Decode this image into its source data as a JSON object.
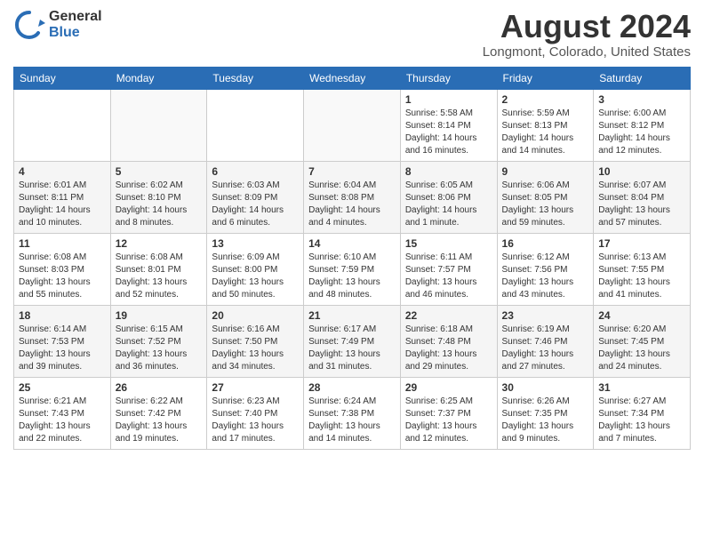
{
  "logo": {
    "general": "General",
    "blue": "Blue"
  },
  "header": {
    "month_year": "August 2024",
    "location": "Longmont, Colorado, United States"
  },
  "weekdays": [
    "Sunday",
    "Monday",
    "Tuesday",
    "Wednesday",
    "Thursday",
    "Friday",
    "Saturday"
  ],
  "weeks": [
    [
      {
        "day": "",
        "info": ""
      },
      {
        "day": "",
        "info": ""
      },
      {
        "day": "",
        "info": ""
      },
      {
        "day": "",
        "info": ""
      },
      {
        "day": "1",
        "info": "Sunrise: 5:58 AM\nSunset: 8:14 PM\nDaylight: 14 hours\nand 16 minutes."
      },
      {
        "day": "2",
        "info": "Sunrise: 5:59 AM\nSunset: 8:13 PM\nDaylight: 14 hours\nand 14 minutes."
      },
      {
        "day": "3",
        "info": "Sunrise: 6:00 AM\nSunset: 8:12 PM\nDaylight: 14 hours\nand 12 minutes."
      }
    ],
    [
      {
        "day": "4",
        "info": "Sunrise: 6:01 AM\nSunset: 8:11 PM\nDaylight: 14 hours\nand 10 minutes."
      },
      {
        "day": "5",
        "info": "Sunrise: 6:02 AM\nSunset: 8:10 PM\nDaylight: 14 hours\nand 8 minutes."
      },
      {
        "day": "6",
        "info": "Sunrise: 6:03 AM\nSunset: 8:09 PM\nDaylight: 14 hours\nand 6 minutes."
      },
      {
        "day": "7",
        "info": "Sunrise: 6:04 AM\nSunset: 8:08 PM\nDaylight: 14 hours\nand 4 minutes."
      },
      {
        "day": "8",
        "info": "Sunrise: 6:05 AM\nSunset: 8:06 PM\nDaylight: 14 hours\nand 1 minute."
      },
      {
        "day": "9",
        "info": "Sunrise: 6:06 AM\nSunset: 8:05 PM\nDaylight: 13 hours\nand 59 minutes."
      },
      {
        "day": "10",
        "info": "Sunrise: 6:07 AM\nSunset: 8:04 PM\nDaylight: 13 hours\nand 57 minutes."
      }
    ],
    [
      {
        "day": "11",
        "info": "Sunrise: 6:08 AM\nSunset: 8:03 PM\nDaylight: 13 hours\nand 55 minutes."
      },
      {
        "day": "12",
        "info": "Sunrise: 6:08 AM\nSunset: 8:01 PM\nDaylight: 13 hours\nand 52 minutes."
      },
      {
        "day": "13",
        "info": "Sunrise: 6:09 AM\nSunset: 8:00 PM\nDaylight: 13 hours\nand 50 minutes."
      },
      {
        "day": "14",
        "info": "Sunrise: 6:10 AM\nSunset: 7:59 PM\nDaylight: 13 hours\nand 48 minutes."
      },
      {
        "day": "15",
        "info": "Sunrise: 6:11 AM\nSunset: 7:57 PM\nDaylight: 13 hours\nand 46 minutes."
      },
      {
        "day": "16",
        "info": "Sunrise: 6:12 AM\nSunset: 7:56 PM\nDaylight: 13 hours\nand 43 minutes."
      },
      {
        "day": "17",
        "info": "Sunrise: 6:13 AM\nSunset: 7:55 PM\nDaylight: 13 hours\nand 41 minutes."
      }
    ],
    [
      {
        "day": "18",
        "info": "Sunrise: 6:14 AM\nSunset: 7:53 PM\nDaylight: 13 hours\nand 39 minutes."
      },
      {
        "day": "19",
        "info": "Sunrise: 6:15 AM\nSunset: 7:52 PM\nDaylight: 13 hours\nand 36 minutes."
      },
      {
        "day": "20",
        "info": "Sunrise: 6:16 AM\nSunset: 7:50 PM\nDaylight: 13 hours\nand 34 minutes."
      },
      {
        "day": "21",
        "info": "Sunrise: 6:17 AM\nSunset: 7:49 PM\nDaylight: 13 hours\nand 31 minutes."
      },
      {
        "day": "22",
        "info": "Sunrise: 6:18 AM\nSunset: 7:48 PM\nDaylight: 13 hours\nand 29 minutes."
      },
      {
        "day": "23",
        "info": "Sunrise: 6:19 AM\nSunset: 7:46 PM\nDaylight: 13 hours\nand 27 minutes."
      },
      {
        "day": "24",
        "info": "Sunrise: 6:20 AM\nSunset: 7:45 PM\nDaylight: 13 hours\nand 24 minutes."
      }
    ],
    [
      {
        "day": "25",
        "info": "Sunrise: 6:21 AM\nSunset: 7:43 PM\nDaylight: 13 hours\nand 22 minutes."
      },
      {
        "day": "26",
        "info": "Sunrise: 6:22 AM\nSunset: 7:42 PM\nDaylight: 13 hours\nand 19 minutes."
      },
      {
        "day": "27",
        "info": "Sunrise: 6:23 AM\nSunset: 7:40 PM\nDaylight: 13 hours\nand 17 minutes."
      },
      {
        "day": "28",
        "info": "Sunrise: 6:24 AM\nSunset: 7:38 PM\nDaylight: 13 hours\nand 14 minutes."
      },
      {
        "day": "29",
        "info": "Sunrise: 6:25 AM\nSunset: 7:37 PM\nDaylight: 13 hours\nand 12 minutes."
      },
      {
        "day": "30",
        "info": "Sunrise: 6:26 AM\nSunset: 7:35 PM\nDaylight: 13 hours\nand 9 minutes."
      },
      {
        "day": "31",
        "info": "Sunrise: 6:27 AM\nSunset: 7:34 PM\nDaylight: 13 hours\nand 7 minutes."
      }
    ]
  ]
}
